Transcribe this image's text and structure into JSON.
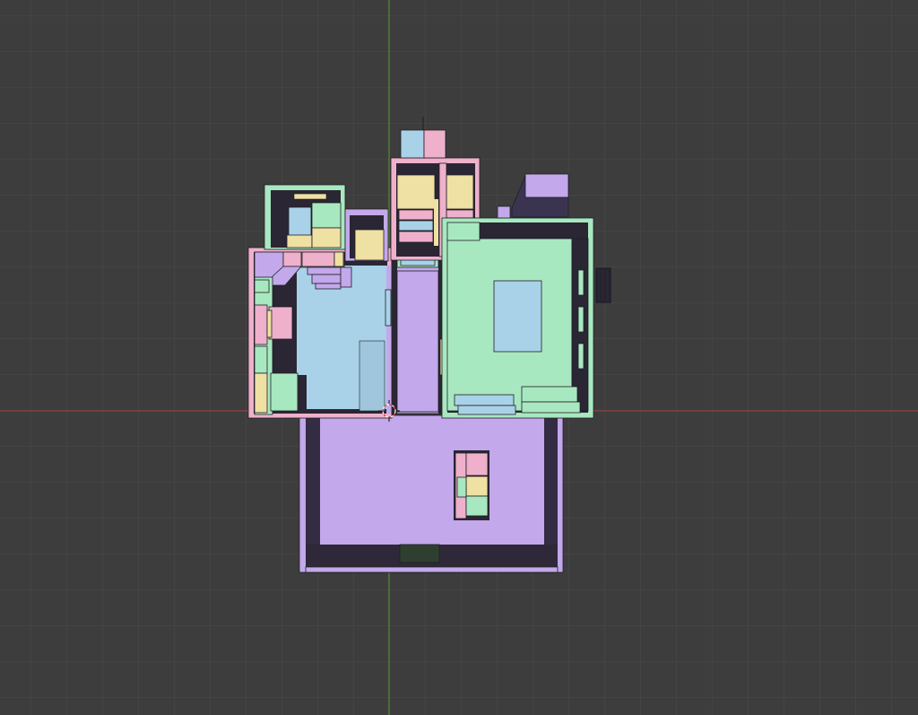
{
  "viewport": {
    "view_name": "top-orthographic",
    "background_color": "#3d3d3d",
    "grid_line_color": "#4a4a4a",
    "x_axis_color": "#a33a3a",
    "y_axis_color": "#5c9b2d",
    "show_grid": true,
    "show_axes": true
  },
  "scene": {
    "object_type": "house-floor-plan",
    "material_palette": {
      "lavender": "#c3a8eb",
      "sky_blue": "#a9d2e8",
      "mint": "#a8e8c0",
      "sand": "#efe0a3",
      "pink": "#efb0cb",
      "shadow": "#2a2634",
      "dark_wall": "#3a3450"
    }
  }
}
